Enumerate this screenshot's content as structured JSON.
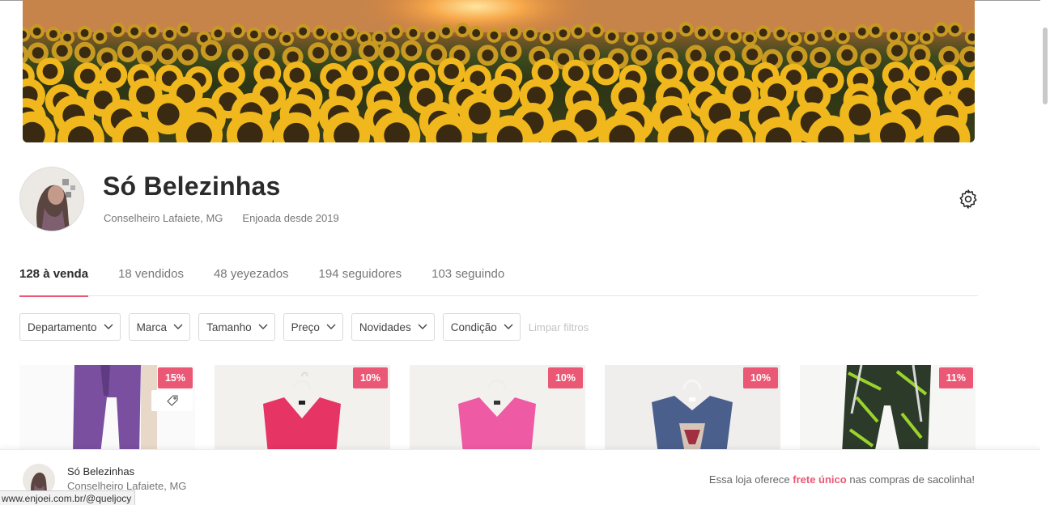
{
  "store": {
    "name": "Só Belezinhas",
    "location": "Conselheiro Lafaiete, MG",
    "member_since": "Enjoada desde 2019"
  },
  "tabs": [
    {
      "label": "128 à venda",
      "active": true
    },
    {
      "label": "18 vendidos",
      "active": false
    },
    {
      "label": "48 yeyezados",
      "active": false
    },
    {
      "label": "194 seguidores",
      "active": false
    },
    {
      "label": "103 seguindo",
      "active": false
    }
  ],
  "filters": [
    "Departamento",
    "Marca",
    "Tamanho",
    "Preço",
    "Novidades",
    "Condição"
  ],
  "clear_filters_label": "Limpar filtros",
  "products": [
    {
      "discount": "15%",
      "icon": "price-tag-icon"
    },
    {
      "discount": "10%"
    },
    {
      "discount": "10%"
    },
    {
      "discount": "10%"
    },
    {
      "discount": "11%"
    }
  ],
  "bottom_bar": {
    "name": "Só Belezinhas",
    "location": "Conselheiro Lafaiete, MG",
    "message_before": "Essa loja oferece ",
    "message_highlight": "frete único",
    "message_after": " nas compras de sacolinha!"
  },
  "status_url": "www.enjoei.com.br/@queljocy",
  "colors": {
    "accent": "#ea5875",
    "text_dark": "#2b2b2b",
    "text_muted": "#777777"
  }
}
